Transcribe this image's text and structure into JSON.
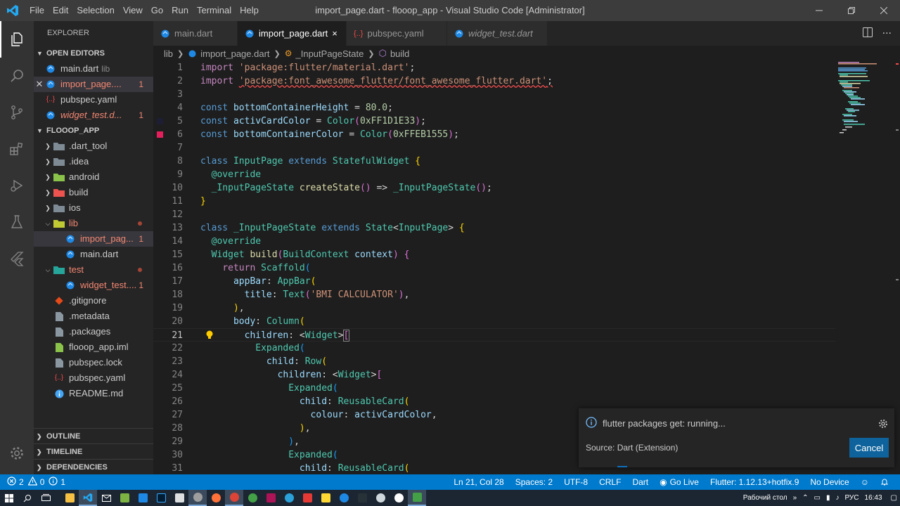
{
  "titlebar": {
    "menu": [
      "File",
      "Edit",
      "Selection",
      "View",
      "Go",
      "Run",
      "Terminal",
      "Help"
    ],
    "title": "import_page.dart - flooop_app - Visual Studio Code [Administrator]"
  },
  "sidebar": {
    "title": "EXPLORER",
    "open_editors_label": "OPEN EDITORS",
    "open_editors": [
      {
        "name": "main.dart",
        "desc": "lib"
      },
      {
        "name": "import_page....",
        "badge": "1"
      },
      {
        "name": "pubspec.yaml"
      },
      {
        "name": "widget_test.d...",
        "badge": "1"
      }
    ],
    "project_label": "FLOOOP_APP",
    "tree": [
      {
        "name": ".dart_tool"
      },
      {
        "name": ".idea"
      },
      {
        "name": "android"
      },
      {
        "name": "build"
      },
      {
        "name": "ios"
      },
      {
        "name": "lib"
      },
      {
        "name": "import_pag...",
        "badge": "1"
      },
      {
        "name": "main.dart"
      },
      {
        "name": "test"
      },
      {
        "name": "widget_test....",
        "badge": "1"
      },
      {
        "name": ".gitignore"
      },
      {
        "name": ".metadata"
      },
      {
        "name": ".packages"
      },
      {
        "name": "flooop_app.iml"
      },
      {
        "name": "pubspec.lock"
      },
      {
        "name": "pubspec.yaml"
      },
      {
        "name": "README.md"
      }
    ],
    "outline_label": "OUTLINE",
    "timeline_label": "TIMELINE",
    "dependencies_label": "DEPENDENCIES"
  },
  "tabs": [
    {
      "label": "main.dart"
    },
    {
      "label": "import_page.dart",
      "close": "×"
    },
    {
      "label": "pubspec.yaml"
    },
    {
      "label": "widget_test.dart"
    }
  ],
  "breadcrumb": [
    "lib",
    "import_page.dart",
    "_InputPageState",
    "build"
  ],
  "editor": {
    "line_numbers": [
      "1",
      "2",
      "3",
      "4",
      "5",
      "6",
      "7",
      "8",
      "9",
      "10",
      "11",
      "12",
      "13",
      "14",
      "15",
      "16",
      "17",
      "18",
      "19",
      "20",
      "21",
      "22",
      "23",
      "24",
      "25",
      "26",
      "27",
      "28",
      "29",
      "30",
      "31"
    ]
  },
  "notification": {
    "message": "flutter packages get: running...",
    "source": "Source: Dart (Extension)",
    "cancel": "Cancel"
  },
  "statusbar": {
    "errors": "2",
    "warnings": "0",
    "infos": "1",
    "position": "Ln 21, Col 28",
    "spaces": "Spaces: 2",
    "encoding": "UTF-8",
    "eol": "CRLF",
    "language": "Dart",
    "golive": "Go Live",
    "flutter": "Flutter: 1.12.13+hotfix.9",
    "device": "No Device"
  },
  "taskbar": {
    "desktop": "Рабочий стол",
    "lang": "РУС",
    "time": "16:43"
  },
  "colors": {
    "accent": "#007acc",
    "activeCard": "#1D1E33",
    "bottomContainer": "#EB1555"
  }
}
